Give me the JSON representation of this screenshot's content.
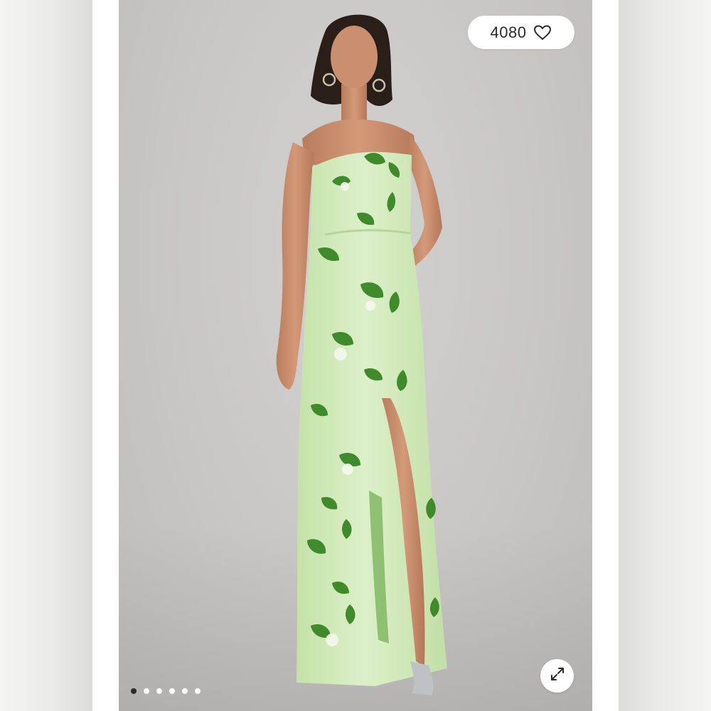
{
  "product_image": {
    "like_count": "4080",
    "like_icon": "heart-outline-icon",
    "expand_icon": "expand-arrows-icon",
    "carousel": {
      "total": 6,
      "active_index": 0
    }
  },
  "colors": {
    "backdrop": "#c8c7c5",
    "dress_base": "#d6ecc0",
    "dress_print": "#3f8a2b",
    "skin": "#c98f6f",
    "hair": "#2a1e18",
    "pill_bg": "#ffffff",
    "active_dot": "#2a2a2a"
  }
}
